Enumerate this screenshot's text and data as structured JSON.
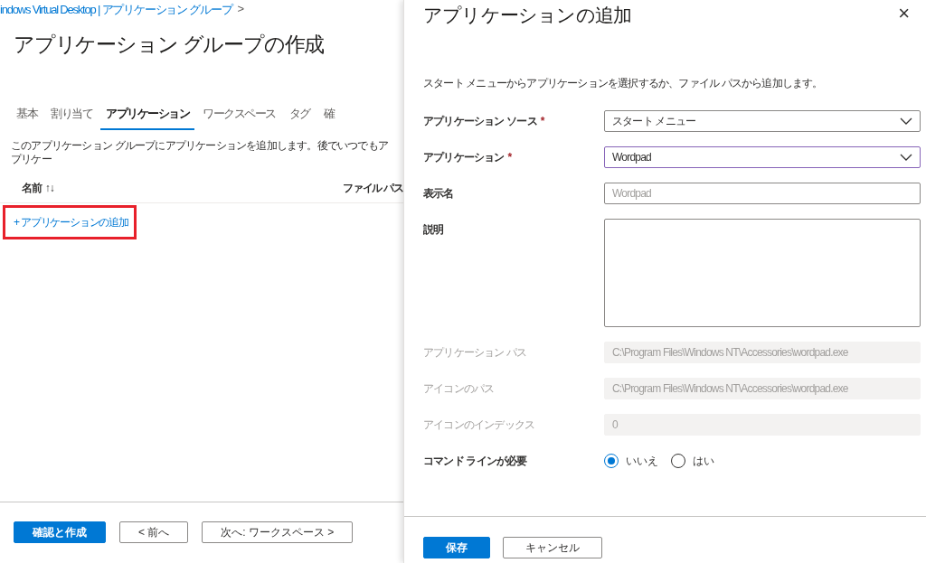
{
  "breadcrumb": {
    "text": "indows Virtual Desktop | アプリケーション グループ",
    "separator": ">"
  },
  "title": "アプリケーション グループの作成",
  "tabs": [
    {
      "label": "基本",
      "selected": false
    },
    {
      "label": "割り当て",
      "selected": false
    },
    {
      "label": "アプリケーション",
      "selected": true
    },
    {
      "label": "ワークスペース",
      "selected": false
    },
    {
      "label": "タグ",
      "selected": false
    },
    {
      "label": "確",
      "selected": false
    }
  ],
  "description": "このアプリケーション グループにアプリケーションを追加します。後でいつでもアプリケー",
  "table": {
    "columns": [
      {
        "label": "名前",
        "sort": "↑↓"
      },
      {
        "label": "ファイル パス"
      }
    ]
  },
  "add_link": {
    "label": "+ アプリケーションの追加",
    "highlighted": true
  },
  "footer_buttons": [
    {
      "label": "確認と作成",
      "primary": true
    },
    {
      "label": "< 前へ",
      "primary": false
    },
    {
      "label": "次へ: ワークスペース >",
      "primary": false
    }
  ],
  "panel": {
    "title": "アプリケーションの追加",
    "close": "×",
    "description": "スタート メニューからアプリケーションを選択するか、ファイル パスから追加します。",
    "fields": [
      {
        "kind": "select",
        "label": "アプリケーション ソース",
        "required_mark": "*",
        "value": "スタート メニュー",
        "focused": false,
        "disabled": false
      },
      {
        "kind": "select",
        "label": "アプリケーション",
        "required_mark": "*",
        "value": "Wordpad",
        "focused": true,
        "disabled": false
      },
      {
        "kind": "text",
        "label": "表示名",
        "placeholder": "Wordpad",
        "focused": false,
        "disabled": false
      },
      {
        "kind": "textarea",
        "label": "説明",
        "focused": false,
        "disabled": false
      },
      {
        "kind": "text",
        "label": "アプリケーション パス",
        "value": "C:\\Program Files\\Windows NT\\Accessories\\wordpad.exe",
        "focused": false,
        "disabled": true
      },
      {
        "kind": "text",
        "label": "アイコンのパス",
        "value": "C:\\Program Files\\Windows NT\\Accessories\\wordpad.exe",
        "focused": false,
        "disabled": true
      },
      {
        "kind": "text",
        "label": "アイコンのインデックス",
        "value": "0",
        "focused": false,
        "disabled": true
      },
      {
        "kind": "radio",
        "label": "コマンド ラインが必要",
        "disabled": false,
        "options": [
          {
            "label": "いいえ",
            "selected": true
          },
          {
            "label": "はい",
            "selected": false
          }
        ]
      }
    ],
    "buttons": [
      {
        "label": "保存",
        "primary": true
      },
      {
        "label": "キャンセル",
        "primary": false
      }
    ]
  }
}
